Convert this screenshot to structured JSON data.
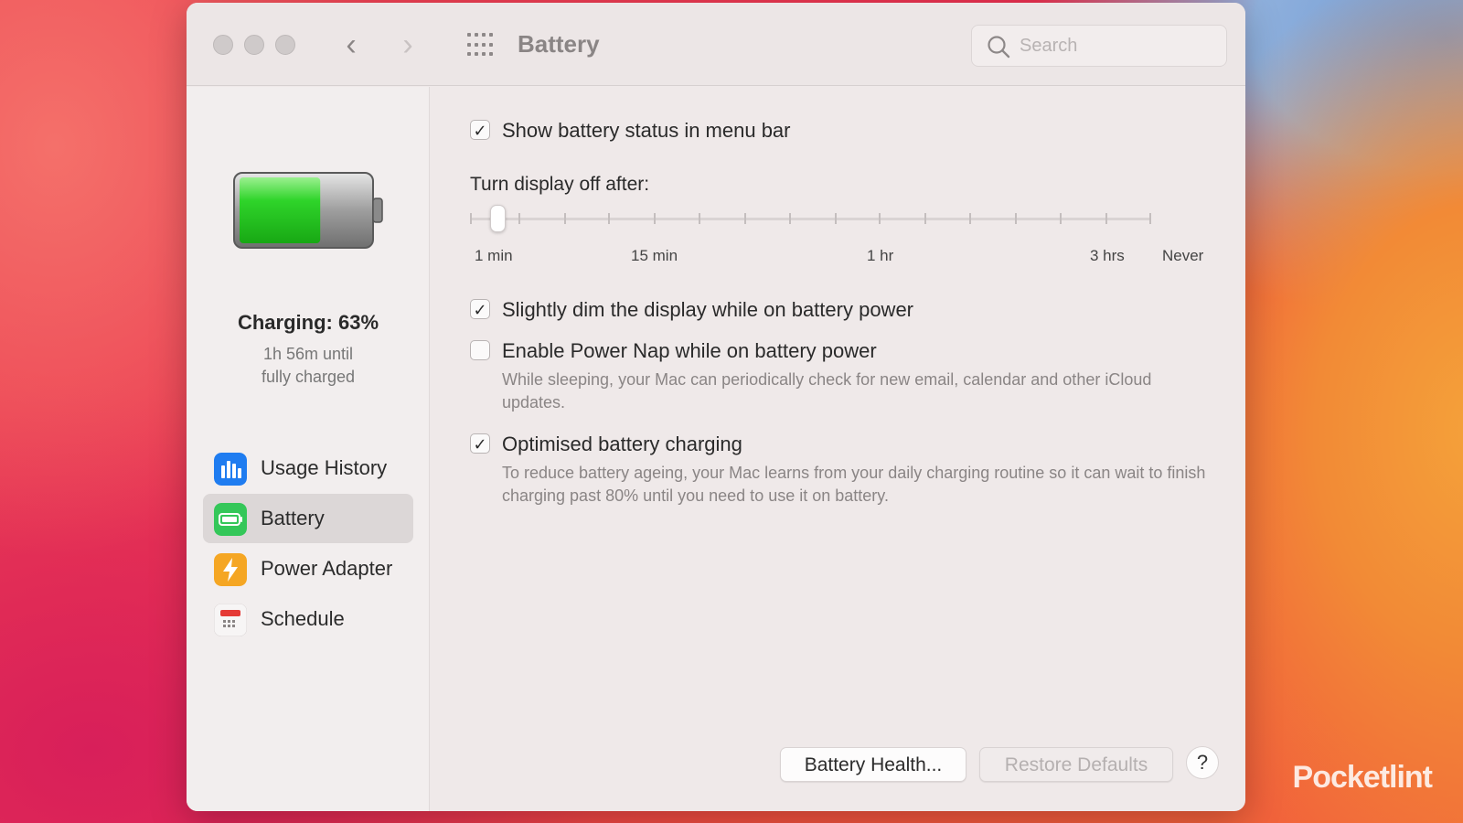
{
  "window": {
    "title": "Battery",
    "search_placeholder": "Search"
  },
  "sidebar": {
    "battery_level_percent": 63,
    "charging_status": "Charging: 63%",
    "time_line1": "1h 56m until",
    "time_line2": "fully charged",
    "items": [
      {
        "label": "Usage History",
        "icon": "bar-chart-icon",
        "color": "#1f7cf0",
        "selected": false
      },
      {
        "label": "Battery",
        "icon": "battery-icon",
        "color": "#34c759",
        "selected": true
      },
      {
        "label": "Power Adapter",
        "icon": "lightning-bolt-icon",
        "color": "#f5a623",
        "selected": false
      },
      {
        "label": "Schedule",
        "icon": "calendar-icon",
        "color": "#e53935",
        "selected": false
      }
    ]
  },
  "settings": {
    "show_status": {
      "label": "Show battery status in menu bar",
      "checked": true
    },
    "display_off": {
      "label": "Turn display off after:",
      "tick_labels": [
        "1 min",
        "15 min",
        "1 hr",
        "3 hrs",
        "Never"
      ],
      "value": "1 min"
    },
    "dim_display": {
      "label": "Slightly dim the display while on battery power",
      "checked": true
    },
    "power_nap": {
      "label": "Enable Power Nap while on battery power",
      "checked": false,
      "description": "While sleeping, your Mac can periodically check for new email, calendar and other iCloud updates."
    },
    "optimised": {
      "label": "Optimised battery charging",
      "checked": true,
      "description": "To reduce battery ageing, your Mac learns from your daily charging routine so it can wait to finish charging past 80% until you need to use it on battery."
    }
  },
  "buttons": {
    "battery_health": "Battery Health...",
    "restore_defaults": "Restore Defaults",
    "help": "?"
  },
  "watermark": "Pocketlint",
  "colors": {
    "accent": "#1f7cf0",
    "battery_green": "#2ecc2e"
  }
}
